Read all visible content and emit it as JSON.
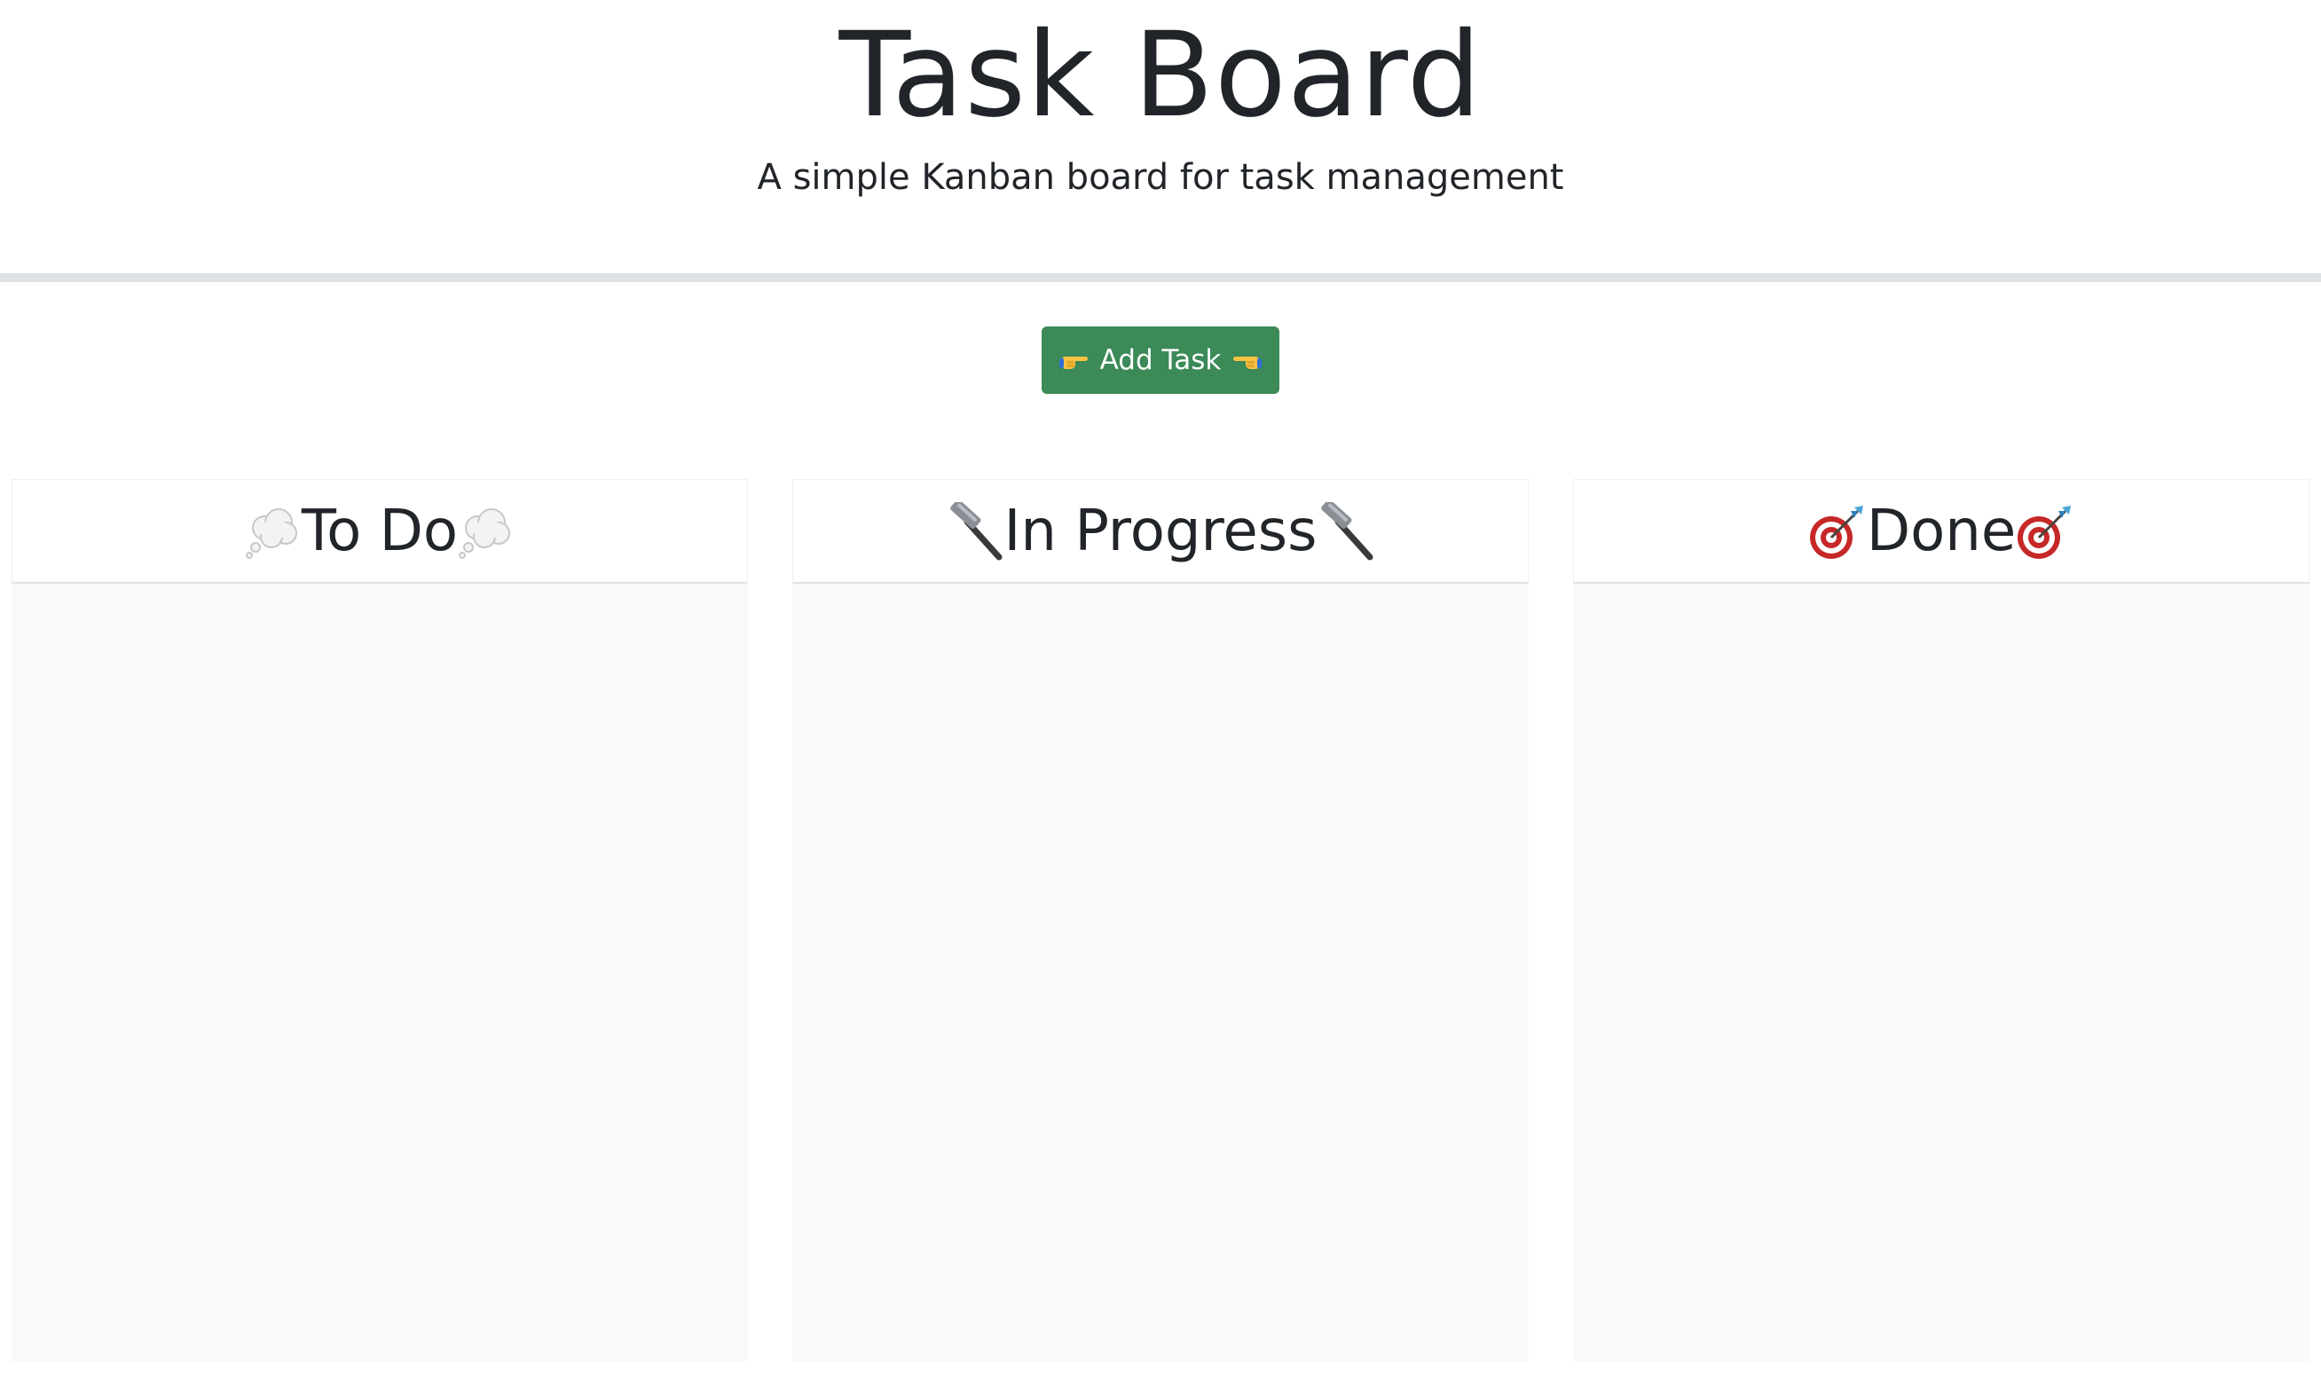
{
  "header": {
    "title": "Task Board",
    "subtitle": "A simple Kanban board for task management"
  },
  "toolbar": {
    "add_label": "Add Task",
    "add_icons": [
      "pointing-right-hand-icon",
      "pointing-left-hand-icon"
    ],
    "add_color": "#3b8a57"
  },
  "columns": [
    {
      "title": "To Do",
      "icon": "thought-bubble-icon",
      "tasks": []
    },
    {
      "title": "In Progress",
      "icon": "hammer-icon",
      "tasks": []
    },
    {
      "title": "Done",
      "icon": "dart-target-icon",
      "tasks": []
    }
  ],
  "colors": {
    "text": "#212529",
    "divider": "#dee2e6",
    "column_background": "#f8f9fa"
  }
}
